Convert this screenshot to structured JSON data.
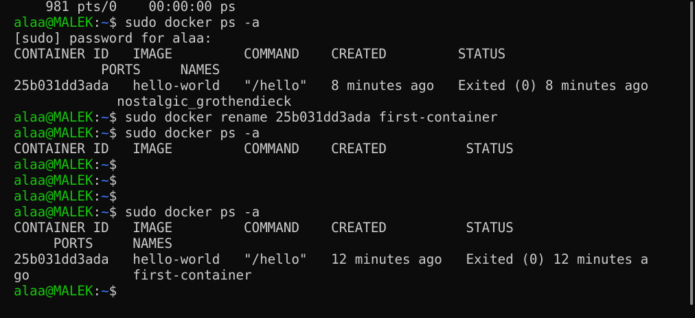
{
  "prompt": {
    "user_host": "alaa@MALEK",
    "separator": ":",
    "path": "~",
    "symbol": "$"
  },
  "lines": [
    {
      "type": "output",
      "text": "    981 pts/0    00:00:00 ps"
    },
    {
      "type": "prompt",
      "cmd": " sudo docker ps -a"
    },
    {
      "type": "output",
      "text": "[sudo] password for alaa:"
    },
    {
      "type": "output",
      "text": "CONTAINER ID   IMAGE         COMMAND    CREATED         STATUS"
    },
    {
      "type": "output",
      "text": "           PORTS     NAMES"
    },
    {
      "type": "output",
      "text": "25b031dd3ada   hello-world   \"/hello\"   8 minutes ago   Exited (0) 8 minutes ago"
    },
    {
      "type": "output",
      "text": "             nostalgic_grothendieck"
    },
    {
      "type": "prompt",
      "cmd": " sudo docker rename 25b031dd3ada first-container"
    },
    {
      "type": "prompt",
      "cmd": " sudo docker ps -a"
    },
    {
      "type": "output",
      "text": "CONTAINER ID   IMAGE         COMMAND    CREATED          STATUS"
    },
    {
      "type": "prompt",
      "cmd": ""
    },
    {
      "type": "prompt",
      "cmd": ""
    },
    {
      "type": "prompt",
      "cmd": ""
    },
    {
      "type": "prompt",
      "cmd": " sudo docker ps -a"
    },
    {
      "type": "output",
      "text": "CONTAINER ID   IMAGE         COMMAND    CREATED          STATUS"
    },
    {
      "type": "output",
      "text": "     PORTS     NAMES"
    },
    {
      "type": "output",
      "text": "25b031dd3ada   hello-world   \"/hello\"   12 minutes ago   Exited (0) 12 minutes a"
    },
    {
      "type": "output",
      "text": "go             first-container"
    },
    {
      "type": "prompt",
      "cmd": ""
    }
  ],
  "colors": {
    "background": "#0c0c0c",
    "text": "#cccccc",
    "user_host": "#16c60c",
    "path": "#3b78ff",
    "scrollbar_thumb": "#8a8a8a"
  }
}
